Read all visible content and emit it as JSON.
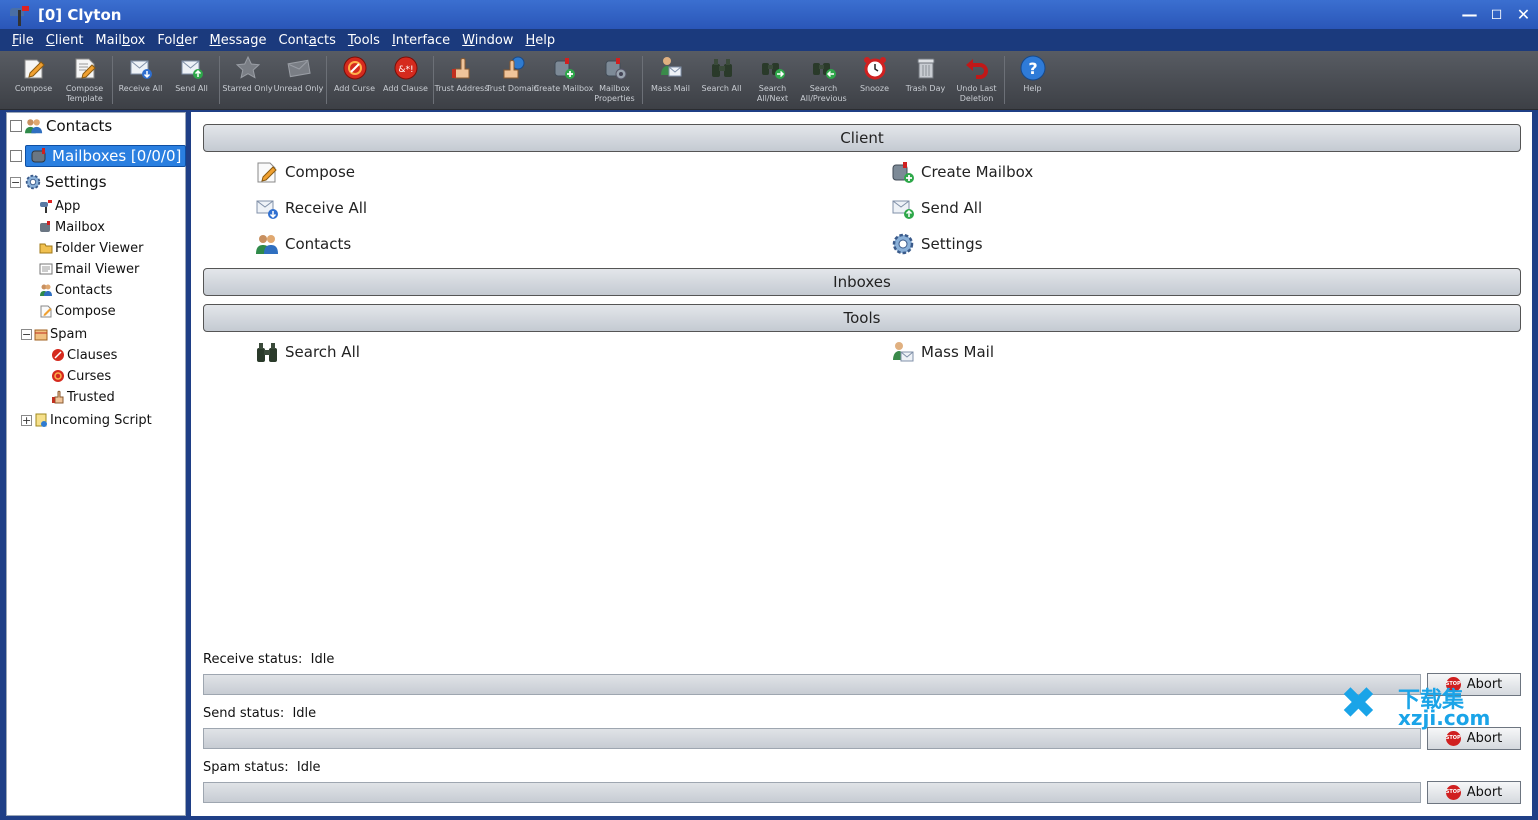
{
  "window": {
    "title": "[0] Clyton"
  },
  "menu": [
    {
      "pre": "",
      "u": "F",
      "post": "ile"
    },
    {
      "pre": "",
      "u": "C",
      "post": "lient"
    },
    {
      "pre": "Mail",
      "u": "b",
      "post": "ox"
    },
    {
      "pre": "Fol",
      "u": "d",
      "post": "er"
    },
    {
      "pre": "",
      "u": "M",
      "post": "essage"
    },
    {
      "pre": "Cont",
      "u": "a",
      "post": "cts"
    },
    {
      "pre": "",
      "u": "T",
      "post": "ools"
    },
    {
      "pre": "",
      "u": "I",
      "post": "nterface"
    },
    {
      "pre": "",
      "u": "W",
      "post": "indow"
    },
    {
      "pre": "",
      "u": "H",
      "post": "elp"
    }
  ],
  "toolbar": [
    {
      "label": "Compose",
      "icon": "compose-icon"
    },
    {
      "label": "Compose Template",
      "icon": "compose-template-icon"
    },
    {
      "label": "Receive All",
      "icon": "receive-all-icon"
    },
    {
      "label": "Send All",
      "icon": "send-all-icon"
    },
    {
      "label": "Starred Only",
      "icon": "star-icon"
    },
    {
      "label": "Unread Only",
      "icon": "unread-envelope-icon"
    },
    {
      "label": "Add Curse",
      "icon": "add-curse-icon"
    },
    {
      "label": "Add Clause",
      "icon": "add-clause-icon"
    },
    {
      "label": "Trust Address",
      "icon": "trust-address-icon"
    },
    {
      "label": "Trust Domain",
      "icon": "trust-domain-icon"
    },
    {
      "label": "Create Mailbox",
      "icon": "create-mailbox-icon"
    },
    {
      "label": "Mailbox Properties",
      "icon": "mailbox-properties-icon"
    },
    {
      "label": "Mass Mail",
      "icon": "mass-mail-icon"
    },
    {
      "label": "Search All",
      "icon": "binoculars-icon"
    },
    {
      "label": "Search All/Next",
      "icon": "search-next-icon"
    },
    {
      "label": "Search All/Previous",
      "icon": "search-previous-icon"
    },
    {
      "label": "Snooze",
      "icon": "alarm-clock-icon"
    },
    {
      "label": "Trash Day",
      "icon": "trash-can-icon"
    },
    {
      "label": "Undo Last Deletion",
      "icon": "undo-icon"
    },
    {
      "label": "Help",
      "icon": "help-icon"
    }
  ],
  "tree": {
    "contacts": "Contacts",
    "mailboxes": "Mailboxes [0/0/0]",
    "settings": "Settings",
    "settings_children": [
      "App",
      "Mailbox",
      "Folder Viewer",
      "Email Viewer",
      "Contacts",
      "Compose"
    ],
    "spam": "Spam",
    "spam_children": [
      "Clauses",
      "Curses",
      "Trusted"
    ],
    "incoming_script": "Incoming Script"
  },
  "main": {
    "client_header": "Client",
    "client_actions_left": [
      "Compose",
      "Receive All",
      "Contacts"
    ],
    "client_actions_right": [
      "Create Mailbox",
      "Send All",
      "Settings"
    ],
    "inboxes_header": "Inboxes",
    "tools_header": "Tools",
    "tools_actions_left": [
      "Search All"
    ],
    "tools_actions_right": [
      "Mass Mail"
    ]
  },
  "status": {
    "receive_label": "Receive status:",
    "receive_value": "Idle",
    "send_label": "Send status:",
    "send_value": "Idle",
    "spam_label": "Spam status:",
    "spam_value": "Idle",
    "abort_label": "Abort",
    "stop_text": "STOP",
    "receive_progress": 0,
    "send_progress": 0,
    "spam_progress": 0
  },
  "watermark": {
    "cn": "下载集",
    "url": "xzji.com"
  }
}
